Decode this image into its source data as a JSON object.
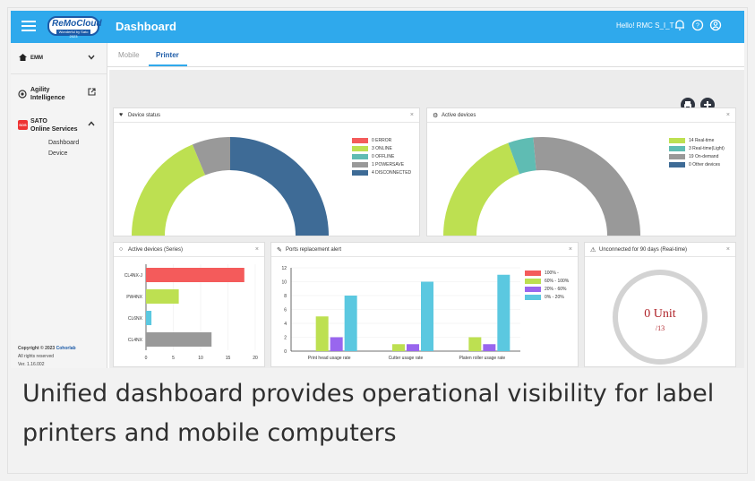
{
  "topbar": {
    "logo": "ReMoCloud",
    "logo_sub": "Wonderful by Sato 2023",
    "title": "Dashboard",
    "greeting": "Hello! RMC S_I_T"
  },
  "sidebar": {
    "emm": "EMM",
    "agility_line1": "Agility",
    "agility_line2": "Intelligence",
    "sato_badge": "SOS",
    "sato_line1": "SATO",
    "sato_line2": "Online Services",
    "sub_dashboard": "Dashboard",
    "sub_device": "Device",
    "copyright_prefix": "Copyright © 2023 ",
    "copyright_link": "Cohorlab",
    "rights": "All rights reserved",
    "version": "Ver. 1.16.002"
  },
  "tabs": {
    "mobile": "Mobile",
    "printer": "Printer"
  },
  "panels": {
    "device_status": {
      "title": "Device status",
      "legend": [
        {
          "label": "0 ERROR",
          "color": "#f45b5b"
        },
        {
          "label": "3 ONLINE",
          "color": "#bde051"
        },
        {
          "label": "0 OFFLINE",
          "color": "#5fbcb3"
        },
        {
          "label": "1 POWERSAVE",
          "color": "#999999"
        },
        {
          "label": "4 DISCONNECTED",
          "color": "#3e6b96"
        }
      ]
    },
    "active_devices": {
      "title": "Active devices",
      "legend": [
        {
          "label": "14 Real-time",
          "color": "#bde051"
        },
        {
          "label": "3 Real-time(Light)",
          "color": "#5fbcb3"
        },
        {
          "label": "19 On-demand",
          "color": "#999999"
        },
        {
          "label": "0 Other devices",
          "color": "#3e6b96"
        }
      ]
    },
    "active_series": {
      "title": "Active devices (Series)"
    },
    "ports": {
      "title": "Ports replacement alert",
      "legend": [
        {
          "label": "100% -",
          "color": "#f45b5b"
        },
        {
          "label": "60% - 100%",
          "color": "#bde051"
        },
        {
          "label": "20% - 60%",
          "color": "#9966ee"
        },
        {
          "label": "0% - 20%",
          "color": "#5bc8e0"
        }
      ]
    },
    "unconnected": {
      "title": "Unconnected for 90 days (Real-time)",
      "value": "0 Unit",
      "total": "/13"
    }
  },
  "caption": "Unified dashboard provides operational visibility for label printers and mobile computers",
  "chart_data": [
    {
      "type": "pie",
      "title": "Device status",
      "categories": [
        "ERROR",
        "ONLINE",
        "OFFLINE",
        "POWERSAVE",
        "DISCONNECTED"
      ],
      "values": [
        0,
        3,
        0,
        1,
        4
      ],
      "colors": [
        "#f45b5b",
        "#bde051",
        "#5fbcb3",
        "#999999",
        "#3e6b96"
      ],
      "style": "semicircle-donut"
    },
    {
      "type": "pie",
      "title": "Active devices",
      "categories": [
        "Real-time",
        "Real-time(Light)",
        "On-demand",
        "Other devices"
      ],
      "values": [
        14,
        3,
        19,
        0
      ],
      "colors": [
        "#bde051",
        "#5fbcb3",
        "#999999",
        "#3e6b96"
      ],
      "style": "semicircle-donut"
    },
    {
      "type": "bar",
      "orientation": "horizontal",
      "title": "Active devices (Series)",
      "categories": [
        "CL4NX-J",
        "PW4NX",
        "CL6NX",
        "CL4NX"
      ],
      "values": [
        18,
        6,
        1,
        12
      ],
      "colors": [
        "#f45b5b",
        "#bde051",
        "#5bc8e0",
        "#999999"
      ],
      "xlim": [
        0,
        20
      ],
      "xticks": [
        0,
        5,
        10,
        15,
        20
      ]
    },
    {
      "type": "bar",
      "title": "Ports replacement alert",
      "categories": [
        "Print head usage rate",
        "Cutter usage rate",
        "Platen roller usage rate"
      ],
      "series": [
        {
          "name": "100% -",
          "values": [
            0,
            0,
            0
          ],
          "color": "#f45b5b"
        },
        {
          "name": "60% - 100%",
          "values": [
            5,
            1,
            2
          ],
          "color": "#bde051"
        },
        {
          "name": "20% - 60%",
          "values": [
            2,
            1,
            1
          ],
          "color": "#9966ee"
        },
        {
          "name": "0% - 20%",
          "values": [
            8,
            10,
            11
          ],
          "color": "#5bc8e0"
        }
      ],
      "ylim": [
        0,
        12
      ],
      "yticks": [
        0,
        2,
        4,
        6,
        8,
        10,
        12
      ]
    }
  ]
}
